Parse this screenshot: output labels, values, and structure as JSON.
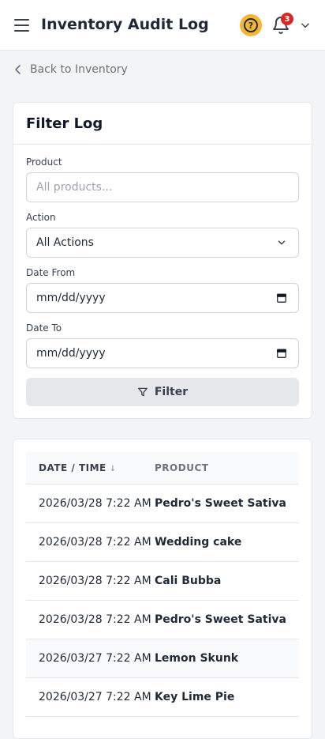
{
  "header": {
    "title": "Inventory Audit Log",
    "notification_count": "3",
    "help_glyph": "?",
    "accent_color": "#f5b731",
    "badge_color": "#dc2626"
  },
  "nav": {
    "back_label": "Back to Inventory"
  },
  "filter": {
    "title": "Filter Log",
    "product_label": "Product",
    "product_placeholder": "All products...",
    "action_label": "Action",
    "action_value": "All Actions",
    "date_from_label": "Date From",
    "date_from_value": "mm/dd/yyyy",
    "date_to_label": "Date To",
    "date_to_value": "mm/dd/yyyy",
    "button_label": "Filter"
  },
  "table": {
    "columns": [
      "DATE / TIME",
      "PRODUCT"
    ],
    "sort_indicator": "↓",
    "rows": [
      {
        "datetime": "2026/03/28 7:22 AM",
        "product": "Pedro's Sweet Sativa"
      },
      {
        "datetime": "2026/03/28 7:22 AM",
        "product": "Wedding cake"
      },
      {
        "datetime": "2026/03/28 7:22 AM",
        "product": "Cali Bubba"
      },
      {
        "datetime": "2026/03/28 7:22 AM",
        "product": "Pedro's Sweet Sativa"
      },
      {
        "datetime": "2026/03/27 7:22 AM",
        "product": "Lemon Skunk"
      },
      {
        "datetime": "2026/03/27 7:22 AM",
        "product": "Key Lime Pie"
      }
    ]
  }
}
